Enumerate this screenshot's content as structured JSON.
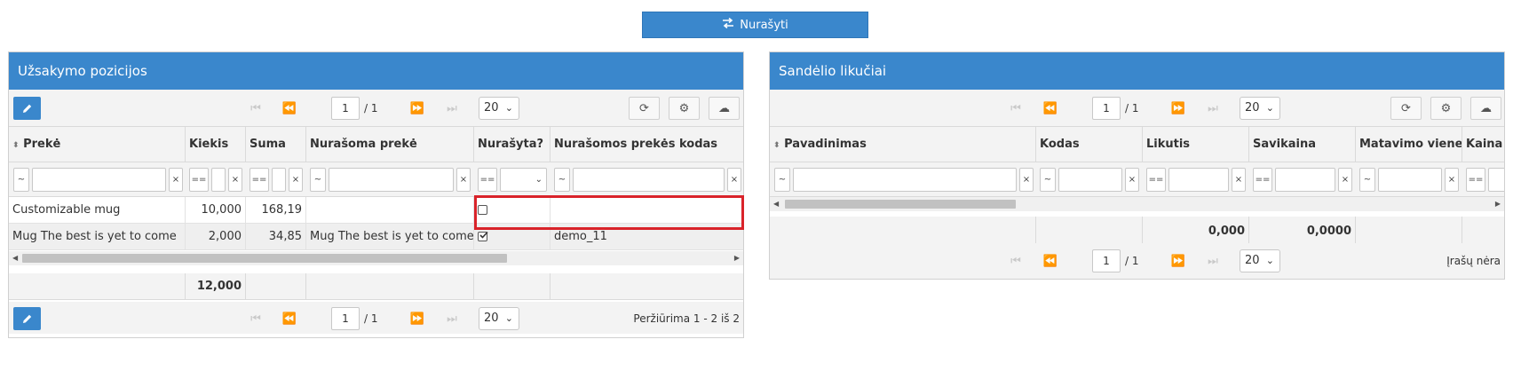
{
  "top_button": {
    "label": "Nurašyti",
    "icon": "exchange-icon",
    "color": "#3a87cc"
  },
  "left_panel": {
    "title": "Užsakymo pozicijos",
    "page_input": "1",
    "page_of": "/ 1",
    "page_size": "20",
    "columns": [
      "Prekė",
      "Kiekis",
      "Suma",
      "Nurašoma prekė",
      "Nurašyta?",
      "Nurašomos prekės kodas"
    ],
    "filters": {
      "preke_op": "~",
      "kiekis_op": "==",
      "suma_op": "==",
      "nurasoma_op": "~",
      "nurasyta_op": "==",
      "kodas_op": "~",
      "clear": "×"
    },
    "rows": [
      {
        "preke": "Customizable mug",
        "kiekis": "10,000",
        "suma": "168,19",
        "nurasoma": "",
        "nurasyta": false,
        "kodas": ""
      },
      {
        "preke": "Mug The best is yet to come",
        "kiekis": "2,000",
        "suma": "34,85",
        "nurasoma": "Mug The best is yet to come",
        "nurasyta": true,
        "kodas": "demo_11"
      }
    ],
    "totals": {
      "kiekis": "12,000"
    },
    "footer_status": "Peržiūrima 1 - 2 iš 2"
  },
  "right_panel": {
    "title": "Sandėlio likučiai",
    "page_input": "1",
    "page_of": "/ 1",
    "page_size": "20",
    "columns": [
      "Pavadinimas",
      "Kodas",
      "Likutis",
      "Savikaina",
      "Matavimo vienet",
      "Kaina l"
    ],
    "filters": {
      "pav_op": "~",
      "kodas_op": "~",
      "likutis_op": "==",
      "savikaina_op": "==",
      "matavimo_op": "~",
      "kaina_op": "==",
      "clear": "×"
    },
    "totals": {
      "likutis": "0,000",
      "savikaina": "0,0000"
    },
    "footer_status": "Įrašų nėra"
  },
  "colors": {
    "accent": "#3a87cc",
    "highlight": "#d9232a"
  }
}
